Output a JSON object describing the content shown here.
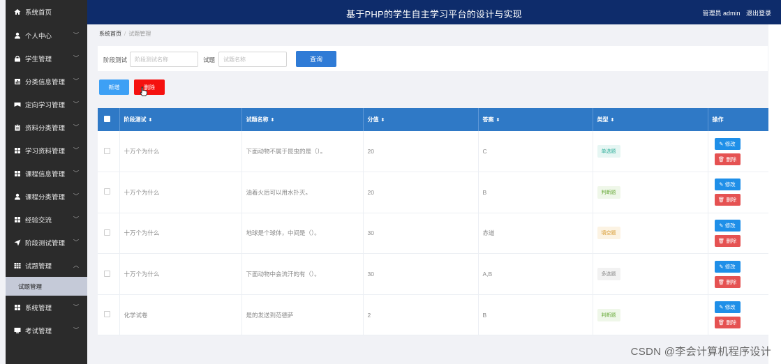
{
  "app": {
    "title": "基于PHP的学生自主学习平台的设计与实现",
    "user_label": "管理员 admin",
    "logout_label": "退出登录"
  },
  "sidebar": {
    "items": [
      {
        "label": "系统首页",
        "icon": "home-icon",
        "chevron": false
      },
      {
        "label": "个人中心",
        "icon": "user-icon",
        "chevron": true
      },
      {
        "label": "学生管理",
        "icon": "lock-icon",
        "chevron": true
      },
      {
        "label": "分类信息管理",
        "icon": "chart-icon",
        "chevron": true
      },
      {
        "label": "定向学习管理",
        "icon": "flag-icon",
        "chevron": true
      },
      {
        "label": "资料分类管理",
        "icon": "clipboard-icon",
        "chevron": true
      },
      {
        "label": "学习资料管理",
        "icon": "grid-icon",
        "chevron": true
      },
      {
        "label": "课程信息管理",
        "icon": "grid-icon",
        "chevron": true
      },
      {
        "label": "课程分类管理",
        "icon": "user-icon",
        "chevron": true
      },
      {
        "label": "经验交流",
        "icon": "grid-icon",
        "chevron": true
      },
      {
        "label": "阶段测试管理",
        "icon": "send-icon",
        "chevron": true
      },
      {
        "label": "试题管理",
        "icon": "table-icon",
        "chevron": true,
        "expanded": true
      }
    ],
    "sub_item": "试题管理",
    "bottom_items": [
      {
        "label": "系统管理",
        "icon": "grid-icon",
        "chevron": true
      },
      {
        "label": "考试管理",
        "icon": "monitor-icon",
        "chevron": true
      }
    ]
  },
  "breadcrumb": {
    "home": "系统首页",
    "current": "试题管理"
  },
  "search": {
    "stage_label": "阶段测试",
    "stage_placeholder": "阶段测试名称",
    "question_label": "试题",
    "question_placeholder": "试题名称",
    "query_button": "查询"
  },
  "actions": {
    "add_label": "新增",
    "delete_label": "删除"
  },
  "table": {
    "columns": [
      "阶段测试",
      "试题名称",
      "分值",
      "答案",
      "类型",
      "操作"
    ],
    "rows": [
      {
        "stage": "十万个为什么",
        "question": "下面动物不属于昆虫的是（）。",
        "score": "20",
        "answer": "C",
        "type": "单选题",
        "type_color": "#2fae9a",
        "type_bg": "#e6f6f3"
      },
      {
        "stage": "十万个为什么",
        "question": "油着火后可以用水扑灭。",
        "score": "20",
        "answer": "B",
        "type": "判断题",
        "type_color": "#6aab3b",
        "type_bg": "#eff7e9"
      },
      {
        "stage": "十万个为什么",
        "question": "地球是个球体，中间是（）。",
        "score": "30",
        "answer": "赤道",
        "type": "填空题",
        "type_color": "#d79a2f",
        "type_bg": "#fcf3e3"
      },
      {
        "stage": "十万个为什么",
        "question": "下面动物中会流汗的有（）。",
        "score": "30",
        "answer": "A,B",
        "type": "多选题",
        "type_color": "#888888",
        "type_bg": "#f2f2f2"
      },
      {
        "stage": "化学试卷",
        "question": "是的发送到范德萨",
        "score": "2",
        "answer": "B",
        "type": "判断题",
        "type_color": "#6aab3b",
        "type_bg": "#eff7e9"
      }
    ],
    "edit_label": "修改",
    "delete_label": "删除"
  },
  "watermark": "CSDN @李会计算机程序设计"
}
